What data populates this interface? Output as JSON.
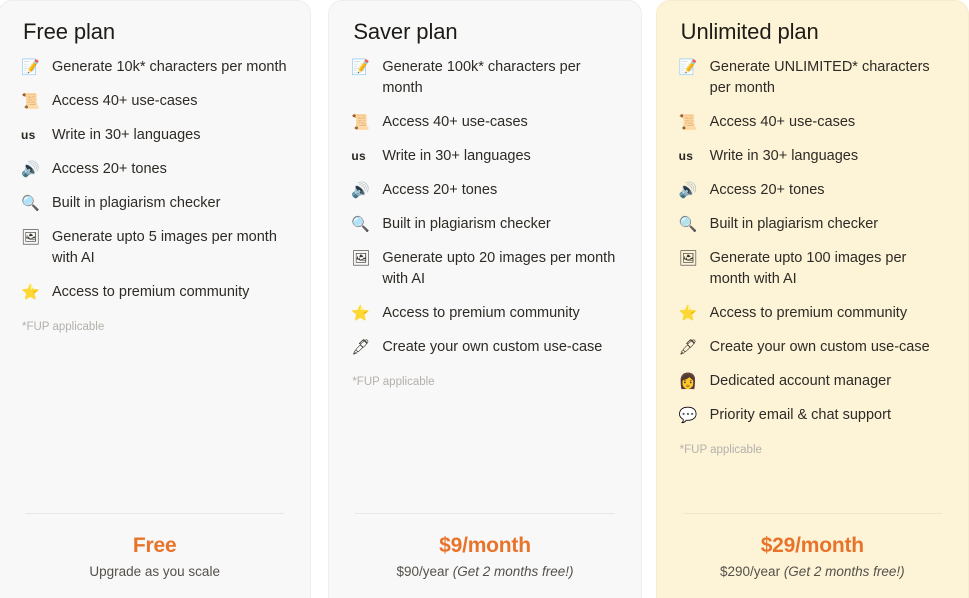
{
  "colors": {
    "accent_orange": "#e8742c",
    "card_plain_bg": "#f8f8f8",
    "card_highlight_bg": "#fdf4d8",
    "border": "#eeeeee",
    "muted_text": "#b4b0ab",
    "body_text": "#2e2a25"
  },
  "plans": [
    {
      "title": "Free plan",
      "highlight": false,
      "features": [
        {
          "icon": "memo-icon",
          "glyph": "📝",
          "text": "Generate 10k* characters per month"
        },
        {
          "icon": "scroll-icon",
          "glyph": "📜",
          "text": "Access 40+ use-cases"
        },
        {
          "icon": "us-flag-icon",
          "glyph": "us",
          "text": "Write in 30+ languages"
        },
        {
          "icon": "speaker-icon",
          "glyph": "🔊",
          "text": "Access 20+ tones"
        },
        {
          "icon": "magnifier-icon",
          "glyph": "🔍",
          "text": "Built in plagiarism checker"
        },
        {
          "icon": "picture-icon",
          "glyph": "🖼",
          "text": "Generate upto 5 images per month with AI"
        },
        {
          "icon": "star-icon",
          "glyph": "⭐",
          "text": "Access to premium community"
        }
      ],
      "fup_note": "*FUP applicable",
      "price_main": "Free",
      "price_sub": "Upgrade as you scale",
      "price_sub_note": ""
    },
    {
      "title": "Saver plan",
      "highlight": false,
      "features": [
        {
          "icon": "memo-icon",
          "glyph": "📝",
          "text": "Generate 100k* characters per month"
        },
        {
          "icon": "scroll-icon",
          "glyph": "📜",
          "text": "Access 40+ use-cases"
        },
        {
          "icon": "us-flag-icon",
          "glyph": "us",
          "text": "Write in 30+ languages"
        },
        {
          "icon": "speaker-icon",
          "glyph": "🔊",
          "text": "Access 20+ tones"
        },
        {
          "icon": "magnifier-icon",
          "glyph": "🔍",
          "text": "Built in plagiarism checker"
        },
        {
          "icon": "picture-icon",
          "glyph": "🖼",
          "text": "Generate upto 20 images per month with AI"
        },
        {
          "icon": "star-icon",
          "glyph": "⭐",
          "text": "Access to premium community"
        },
        {
          "icon": "pen-icon",
          "glyph": "🖋",
          "text": "Create your own custom use-case"
        }
      ],
      "fup_note": "*FUP applicable",
      "price_main": "$9/month",
      "price_sub": "$90/year ",
      "price_sub_note": "(Get 2 months free!)"
    },
    {
      "title": "Unlimited plan",
      "highlight": true,
      "features": [
        {
          "icon": "memo-icon",
          "glyph": "📝",
          "text": "Generate UNLIMITED* characters per month"
        },
        {
          "icon": "scroll-icon",
          "glyph": "📜",
          "text": "Access 40+ use-cases"
        },
        {
          "icon": "us-flag-icon",
          "glyph": "us",
          "text": "Write in 30+ languages"
        },
        {
          "icon": "speaker-icon",
          "glyph": "🔊",
          "text": "Access 20+ tones"
        },
        {
          "icon": "magnifier-icon",
          "glyph": "🔍",
          "text": "Built in plagiarism checker"
        },
        {
          "icon": "picture-icon",
          "glyph": "🖼",
          "text": "Generate upto 100 images per month with AI"
        },
        {
          "icon": "star-icon",
          "glyph": "⭐",
          "text": "Access to premium community"
        },
        {
          "icon": "pen-icon",
          "glyph": "🖋",
          "text": "Create your own custom use-case"
        },
        {
          "icon": "account-manager-icon",
          "glyph": "👩",
          "text": "Dedicated account manager"
        },
        {
          "icon": "chat-bubble-icon",
          "glyph": "💬",
          "text": "Priority email & chat support"
        }
      ],
      "fup_note": "*FUP applicable",
      "price_main": "$29/month",
      "price_sub": "$290/year ",
      "price_sub_note": "(Get 2 months free!)"
    }
  ]
}
